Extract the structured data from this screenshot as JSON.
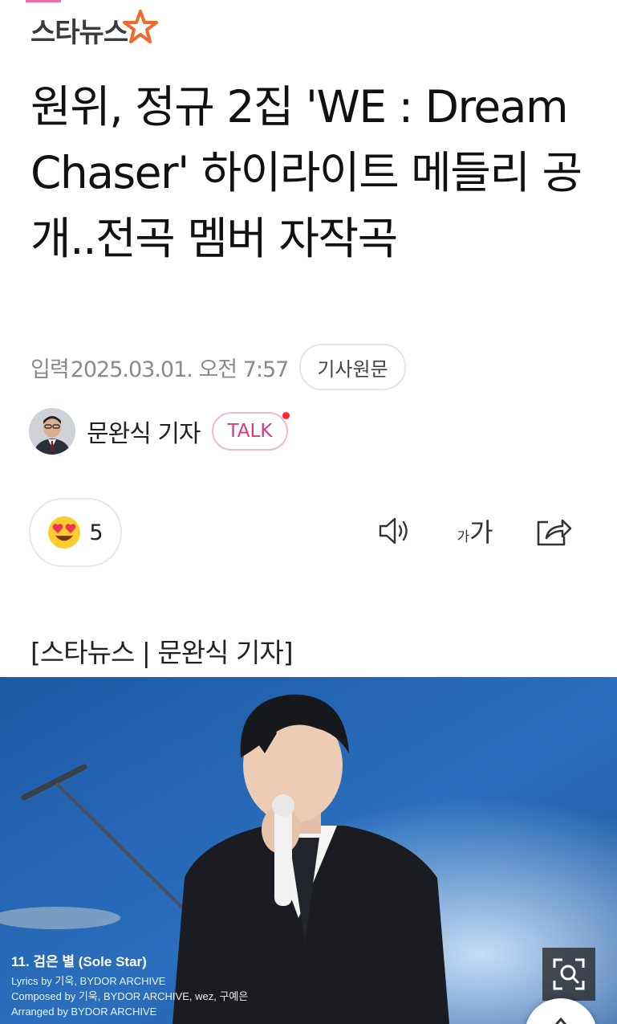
{
  "brand": {
    "name": "스타뉴스",
    "accent": "#f06a2a"
  },
  "headline": "원위, 정규 2집 'WE : Dream Chaser' 하이라이트 메들리 공개..전곡 멤버 자작곡",
  "meta": {
    "label": "입력",
    "datetime": "2025.03.01. 오전 7:57",
    "original_button": "기사원문"
  },
  "reporter": {
    "name": "문완식 기자",
    "talk_label": "TALK"
  },
  "reaction": {
    "emoji": "heart-eyes",
    "count": "5"
  },
  "toolbar": {
    "font_size_small": "가",
    "font_size_large": "가",
    "icons": [
      "speaker-icon",
      "font-size-icon",
      "share-icon"
    ]
  },
  "byline": "[스타뉴스 | 문완식 기자]",
  "photo_caption": {
    "title": "11. 검은 별 (Sole Star)",
    "lines": [
      "Lyrics by 기욱, BYDOR ARCHIVE",
      "Composed by 기욱, BYDOR ARCHIVE, wez, 구예은",
      "Arranged by BYDOR ARCHIVE"
    ]
  }
}
